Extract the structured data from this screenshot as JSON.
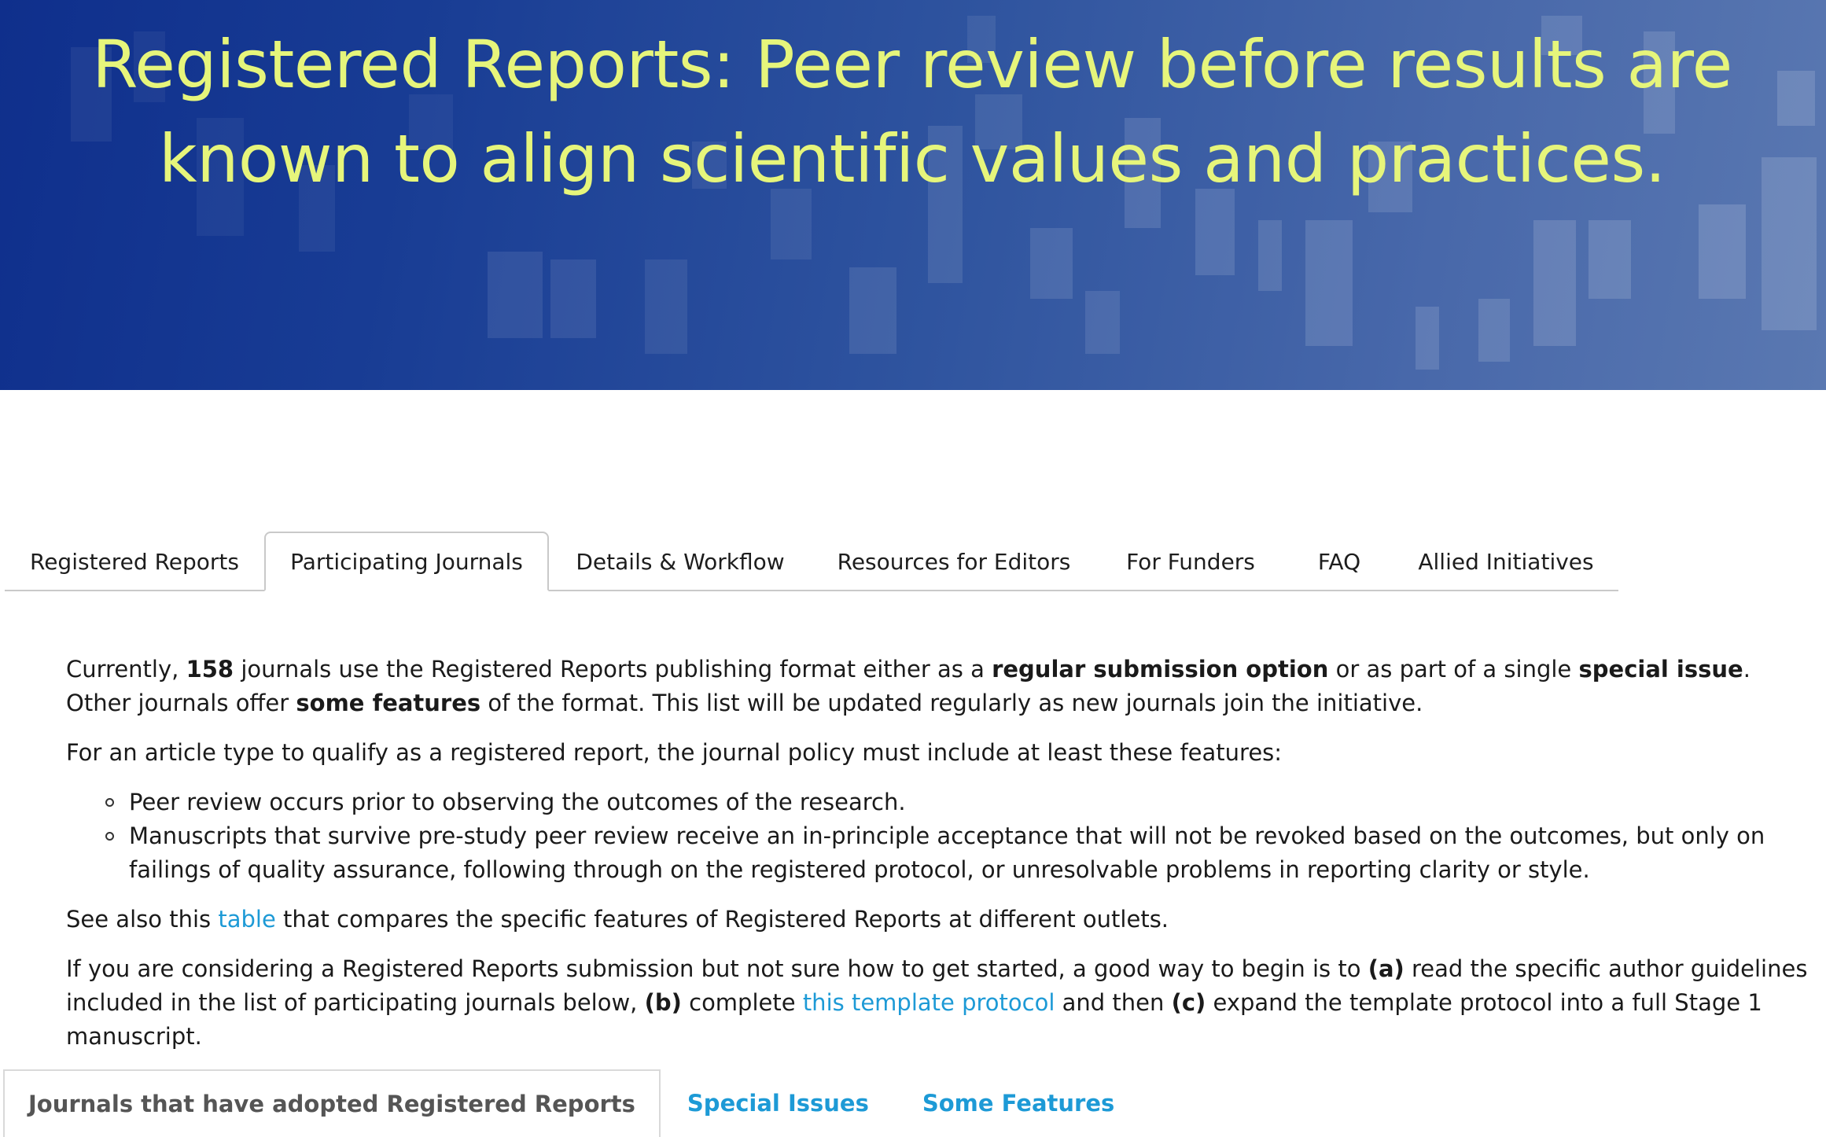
{
  "hero": {
    "title_line1": "Registered Reports: Peer review before results are",
    "title_line2": "known to align scientific values and practices."
  },
  "tabs": [
    {
      "label": "Registered Reports",
      "active": false
    },
    {
      "label": "Participating Journals",
      "active": true
    },
    {
      "label": "Details & Workflow",
      "active": false
    },
    {
      "label": "Resources for Editors",
      "active": false
    },
    {
      "label": "For Funders",
      "active": false
    },
    {
      "label": "FAQ",
      "active": false
    },
    {
      "label": "Allied Initiatives",
      "active": false
    }
  ],
  "intro": {
    "t1": "Currently, ",
    "count": "158",
    "t2": " journals use the Registered Reports publishing format either as a ",
    "regular": "regular submission option",
    "t3": " or as part of a single ",
    "special": "special issue",
    "t4": ". Other journals offer ",
    "some": "some features",
    "t5": " of the format. This list will be updated regularly as new journals join the initiative."
  },
  "qualify_text": "For an article type to qualify as a registered report, the journal policy must include at least these features:",
  "criteria": [
    "Peer review occurs prior to observing the outcomes of the research.",
    "Manuscripts that survive pre-study peer review receive an in-principle acceptance that will not be revoked based on the outcomes, but only on failings of quality assurance, following through on the registered protocol, or unresolvable problems in reporting clarity or style."
  ],
  "see_also": {
    "t1": "See also this ",
    "link": "table",
    "t2": " that compares the specific features of Registered Reports at different outlets."
  },
  "considering": {
    "t1": "If you are considering a Registered Reports submission but not sure how to get started, a good way to begin is to ",
    "a": "(a)",
    "t2": " read the specific author guidelines included in the list of participating journals below, ",
    "b": "(b)",
    "t3": " complete ",
    "link": "this template protocol",
    "t4": " and then ",
    "c": "(c)",
    "t5": " expand the template protocol into a full Stage 1 manuscript."
  },
  "subtabs": [
    {
      "label": "Journals that have adopted Registered Reports",
      "active": true
    },
    {
      "label": "Special Issues",
      "active": false
    },
    {
      "label": "Some Features",
      "active": false
    }
  ],
  "colors": {
    "hero_title": "#e6f57b",
    "link": "#1d9ad6",
    "hero_bg": "#1a3c94"
  }
}
